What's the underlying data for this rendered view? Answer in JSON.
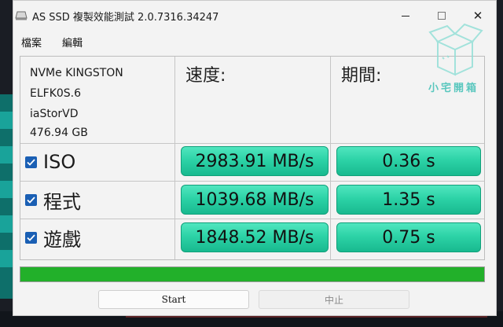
{
  "window": {
    "title": "AS SSD 複製效能測試 2.0.7316.34247",
    "minimize_symbol": "—",
    "maximize_symbol": "☐",
    "close_symbol": "✕"
  },
  "watermark": {
    "text": "小宅開箱"
  },
  "menu": [
    {
      "label": "檔案"
    },
    {
      "label": "編輯"
    }
  ],
  "drive": {
    "model": "NVMe KINGSTON",
    "firmware": "ELFK0S.6",
    "driver": "iaStorVD",
    "size": "476.94 GB"
  },
  "columns": {
    "speed": "速度:",
    "time": "期間:"
  },
  "rows": [
    {
      "label": "ISO",
      "checked": true,
      "speed": "2983.91 MB/s",
      "time": "0.36 s"
    },
    {
      "label": "程式",
      "checked": true,
      "speed": "1039.68 MB/s",
      "time": "1.35 s"
    },
    {
      "label": "遊戲",
      "checked": true,
      "speed": "1848.52 MB/s",
      "time": "0.75 s"
    }
  ],
  "progress": {
    "percent": 100,
    "color": "#22b02a"
  },
  "buttons": {
    "start": "Start",
    "stop": "中止"
  },
  "colors": {
    "result_cell": "#2dd3a7",
    "checkbox": "#1a5fb4"
  }
}
